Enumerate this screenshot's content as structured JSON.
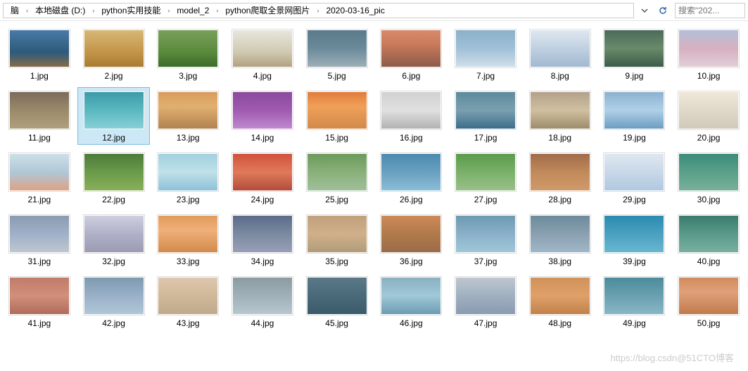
{
  "breadcrumb": {
    "items": [
      "脑",
      "本地磁盘 (D:)",
      "python实用技能",
      "model_2",
      "python爬取全景网图片",
      "2020-03-16_pic"
    ]
  },
  "search": {
    "placeholder": "搜索\"202..."
  },
  "selected_index": 11,
  "files": [
    {
      "name": "1.jpg",
      "palette": 0
    },
    {
      "name": "2.jpg",
      "palette": 1
    },
    {
      "name": "3.jpg",
      "palette": 2
    },
    {
      "name": "4.jpg",
      "palette": 3
    },
    {
      "name": "5.jpg",
      "palette": 4
    },
    {
      "name": "6.jpg",
      "palette": 5
    },
    {
      "name": "7.jpg",
      "palette": 6
    },
    {
      "name": "8.jpg",
      "palette": 7
    },
    {
      "name": "9.jpg",
      "palette": 8
    },
    {
      "name": "10.jpg",
      "palette": 9
    },
    {
      "name": "11.jpg",
      "palette": 10
    },
    {
      "name": "12.jpg",
      "palette": 11
    },
    {
      "name": "13.jpg",
      "palette": 12
    },
    {
      "name": "14.jpg",
      "palette": 13
    },
    {
      "name": "15.jpg",
      "palette": 14
    },
    {
      "name": "16.jpg",
      "palette": 15
    },
    {
      "name": "17.jpg",
      "palette": 16
    },
    {
      "name": "18.jpg",
      "palette": 17
    },
    {
      "name": "19.jpg",
      "palette": 18
    },
    {
      "name": "20.jpg",
      "palette": 19
    },
    {
      "name": "21.jpg",
      "palette": 20
    },
    {
      "name": "22.jpg",
      "palette": 21
    },
    {
      "name": "23.jpg",
      "palette": 22
    },
    {
      "name": "24.jpg",
      "palette": 23
    },
    {
      "name": "25.jpg",
      "palette": 24
    },
    {
      "name": "26.jpg",
      "palette": 25
    },
    {
      "name": "27.jpg",
      "palette": 26
    },
    {
      "name": "28.jpg",
      "palette": 27
    },
    {
      "name": "29.jpg",
      "palette": 28
    },
    {
      "name": "30.jpg",
      "palette": 29
    },
    {
      "name": "31.jpg",
      "palette": 30
    },
    {
      "name": "32.jpg",
      "palette": 31
    },
    {
      "name": "33.jpg",
      "palette": 32
    },
    {
      "name": "34.jpg",
      "palette": 33
    },
    {
      "name": "35.jpg",
      "palette": 34
    },
    {
      "name": "36.jpg",
      "palette": 35
    },
    {
      "name": "37.jpg",
      "palette": 36
    },
    {
      "name": "38.jpg",
      "palette": 37
    },
    {
      "name": "39.jpg",
      "palette": 38
    },
    {
      "name": "40.jpg",
      "palette": 39
    },
    {
      "name": "41.jpg",
      "palette": 40
    },
    {
      "name": "42.jpg",
      "palette": 41
    },
    {
      "name": "43.jpg",
      "palette": 42
    },
    {
      "name": "44.jpg",
      "palette": 43
    },
    {
      "name": "45.jpg",
      "palette": 44
    },
    {
      "name": "46.jpg",
      "palette": 45
    },
    {
      "name": "47.jpg",
      "palette": 46
    },
    {
      "name": "48.jpg",
      "palette": 47
    },
    {
      "name": "49.jpg",
      "palette": 48
    },
    {
      "name": "50.jpg",
      "palette": 49
    }
  ],
  "watermark": "https://blog.csdn@51CTO博客"
}
